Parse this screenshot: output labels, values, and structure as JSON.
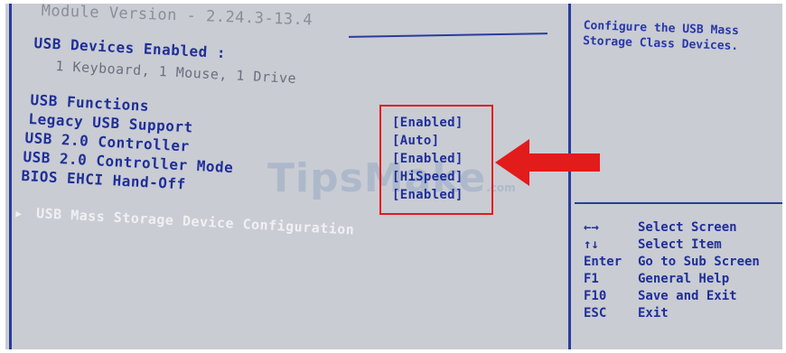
{
  "header": {
    "version_line": "Module Version - 2.24.3-13.4"
  },
  "devices": {
    "title": "USB Devices Enabled :",
    "summary": "1 Keyboard, 1 Mouse, 1 Drive"
  },
  "functions": {
    "title": "USB Functions",
    "items": [
      {
        "label": "Legacy USB Support",
        "value": "[Enabled]"
      },
      {
        "label": "USB 2.0 Controller",
        "value": "[Auto]"
      },
      {
        "label": "USB 2.0 Controller Mode",
        "value": "[Enabled]"
      },
      {
        "label": "BIOS EHCI Hand-Off",
        "value": "[HiSpeed]"
      }
    ],
    "extra_value": "[Enabled]"
  },
  "submenu": {
    "arrow": "▶",
    "label": "USB Mass Storage Device Configuration"
  },
  "help": {
    "description": "Configure the USB Mass Storage Class Devices."
  },
  "keys": [
    {
      "key": "←→",
      "action": "Select Screen"
    },
    {
      "key": "↑↓",
      "action": "Select Item"
    },
    {
      "key": "Enter",
      "action": "Go to Sub Screen"
    },
    {
      "key": "F1",
      "action": "General Help"
    },
    {
      "key": "F10",
      "action": "Save and Exit"
    },
    {
      "key": "ESC",
      "action": "Exit"
    }
  ],
  "watermark": {
    "text": "TipsMake",
    "suffix": ".com"
  },
  "colors": {
    "screen_bg": "#c9ccd3",
    "text_blue": "#1f2f98",
    "highlight_red": "#e21b1b"
  }
}
